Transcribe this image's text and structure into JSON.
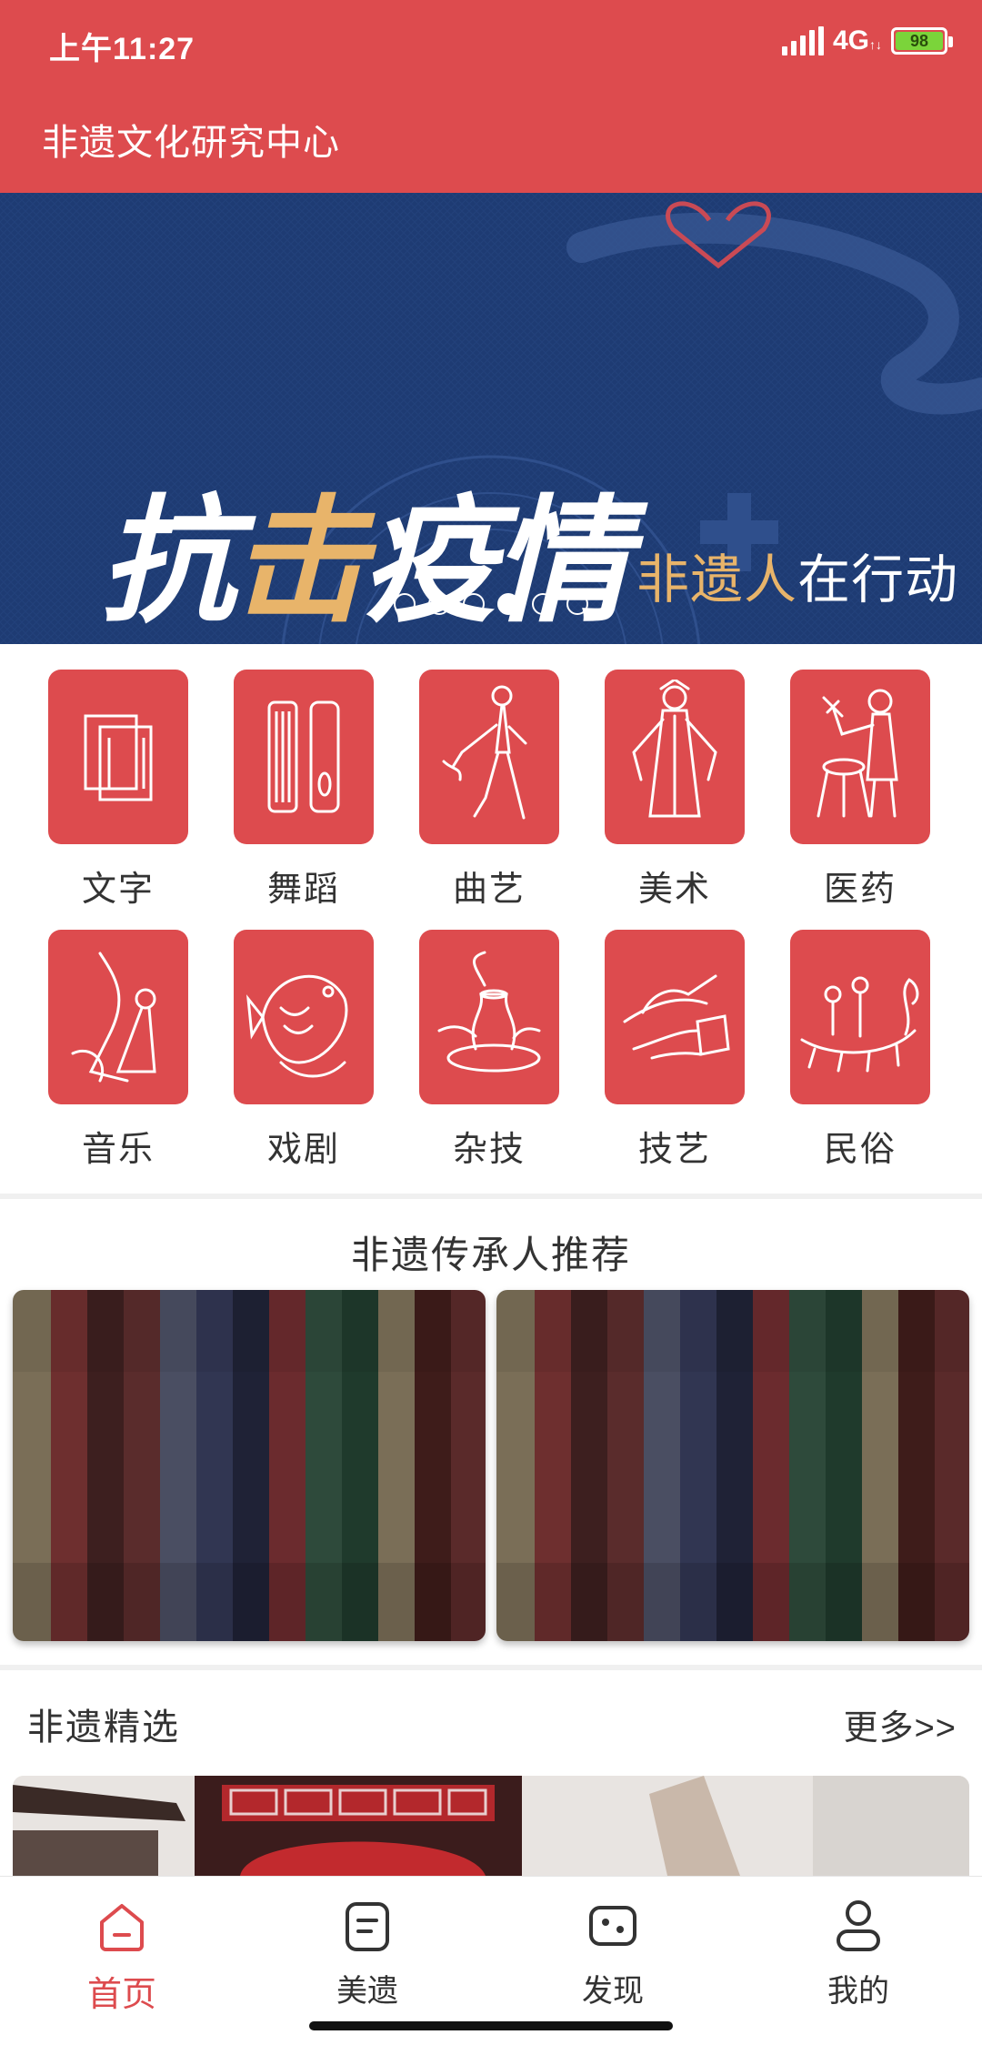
{
  "status_bar": {
    "time": "上午11:27",
    "network": "4G",
    "battery": "98"
  },
  "header": {
    "title": "非遗文化研究中心"
  },
  "banner": {
    "main_part1": "抗",
    "main_part2": "击",
    "main_part3": "疫情",
    "sub_part1": "非遗人",
    "sub_part2": "在行动",
    "dot_count": 6,
    "active_dot": 3
  },
  "categories": [
    {
      "label": "文字",
      "icon": "book-icon"
    },
    {
      "label": "舞蹈",
      "icon": "guqin-icon"
    },
    {
      "label": "曲艺",
      "icon": "dancer-icon"
    },
    {
      "label": "美术",
      "icon": "opera-figure-icon"
    },
    {
      "label": "医药",
      "icon": "herbalist-icon"
    },
    {
      "label": "音乐",
      "icon": "musician-icon"
    },
    {
      "label": "戏剧",
      "icon": "carp-icon"
    },
    {
      "label": "杂技",
      "icon": "pottery-icon"
    },
    {
      "label": "技艺",
      "icon": "craft-hands-icon"
    },
    {
      "label": "民俗",
      "icon": "dragon-boat-icon"
    }
  ],
  "inheritors": {
    "title": "非遗传承人推荐"
  },
  "featured": {
    "title": "非遗精选",
    "more_label": "更多>>"
  },
  "colors": {
    "accent": "#dd4b4e",
    "banner_bg": "#1e3b73",
    "gold": "#e8b46a"
  },
  "bottom_nav": [
    {
      "label": "首页",
      "icon": "home-icon",
      "active": true
    },
    {
      "label": "美遗",
      "icon": "document-icon",
      "active": false
    },
    {
      "label": "发现",
      "icon": "discover-icon",
      "active": false
    },
    {
      "label": "我的",
      "icon": "profile-icon",
      "active": false
    }
  ]
}
